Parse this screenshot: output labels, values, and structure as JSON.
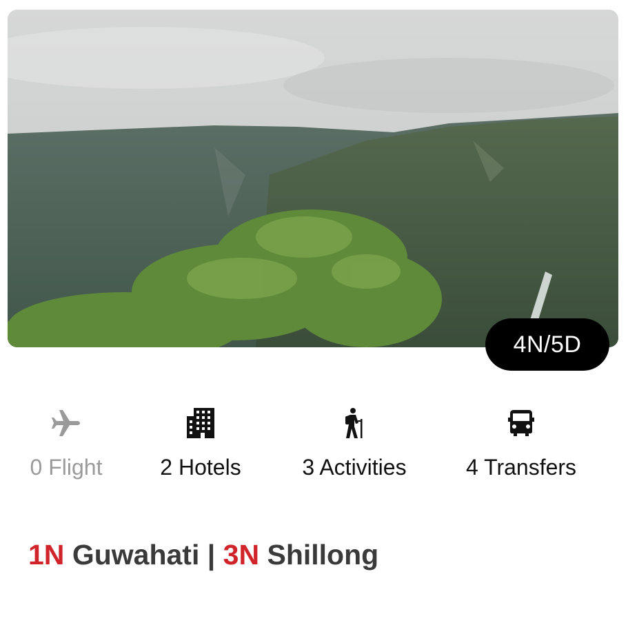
{
  "package": {
    "duration_badge": "4N/5D",
    "image_alt": "Green hills with waterfall under cloudy sky"
  },
  "amenities": [
    {
      "label": "0 Flight",
      "icon": "airplane-icon",
      "enabled": false
    },
    {
      "label": "2 Hotels",
      "icon": "hotel-building-icon",
      "enabled": true
    },
    {
      "label": "3 Activities",
      "icon": "hiker-icon",
      "enabled": true
    },
    {
      "label": "4 Transfers",
      "icon": "car-icon",
      "enabled": true
    }
  ],
  "route": [
    {
      "nights": "1N",
      "city": "Guwahati"
    },
    {
      "nights": "3N",
      "city": "Shillong"
    }
  ],
  "route_separator": "|",
  "colors": {
    "accent_red": "#d0232a",
    "city_text": "#3a3a3a",
    "disabled_text": "#9a9a9a",
    "badge_bg": "#000000"
  }
}
